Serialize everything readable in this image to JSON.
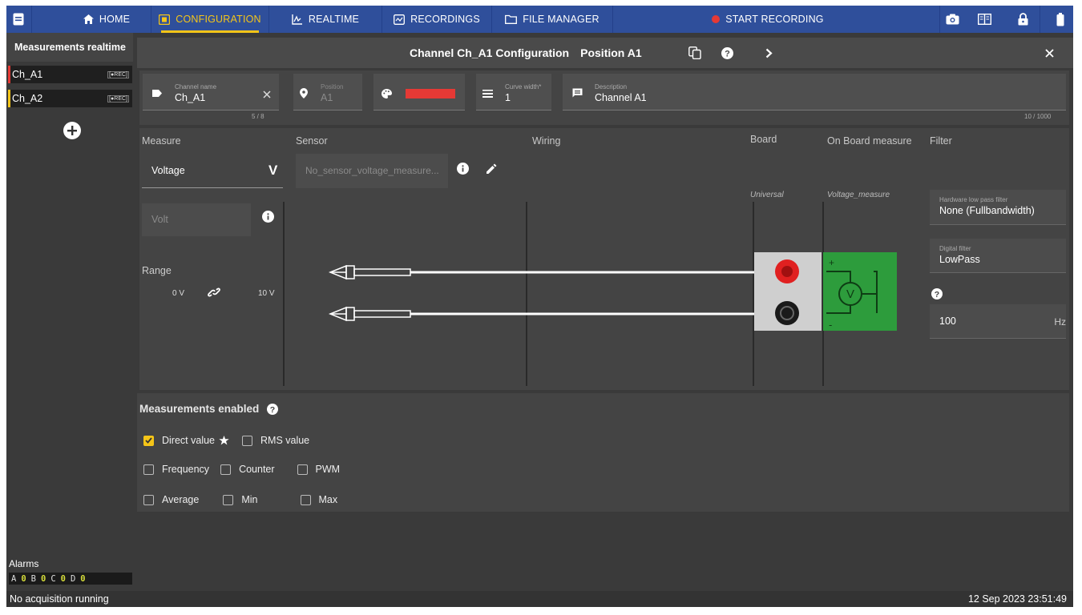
{
  "nav": {
    "tabs": [
      {
        "label": "HOME",
        "icon": "home-icon"
      },
      {
        "label": "CONFIGURATION",
        "icon": "settings-chip-icon"
      },
      {
        "label": "REALTIME",
        "icon": "realtime-icon"
      },
      {
        "label": "RECORDINGS",
        "icon": "recordings-icon"
      },
      {
        "label": "FILE MANAGER",
        "icon": "folder-icon"
      }
    ],
    "start_recording": "START RECORDING",
    "active_tab": "CONFIGURATION"
  },
  "sidebar": {
    "title": "Measurements realtime",
    "channels": [
      {
        "name": "Ch_A1",
        "tag": "[●REC]",
        "color": "#e53935"
      },
      {
        "name": "Ch_A2",
        "tag": "[●REC]",
        "color": "#f5c518"
      }
    ],
    "alarms_label": "Alarms",
    "alarms": [
      {
        "key": "A",
        "value": "0"
      },
      {
        "key": "B",
        "value": "0"
      },
      {
        "key": "C",
        "value": "0"
      },
      {
        "key": "D",
        "value": "0"
      }
    ]
  },
  "header": {
    "title": "Channel Ch_A1 Configuration",
    "position": "Position A1"
  },
  "channel": {
    "name_label": "Channel name",
    "name": "Ch_A1",
    "name_counter": "5 / 8",
    "position_label": "Position",
    "position": "A1",
    "color": "#e53935",
    "curve_width_label": "Curve width*",
    "curve_width": "1",
    "description_label": "Description",
    "description": "Channel A1",
    "description_counter": "10 / 1000"
  },
  "config": {
    "headers": {
      "measure": "Measure",
      "sensor": "Sensor",
      "wiring": "Wiring",
      "board": "Board",
      "onboard": "On Board measure",
      "filter": "Filter"
    },
    "measure_value": "Voltage",
    "measure_symbol": "V",
    "sensor_value": "No_sensor_voltage_measure...",
    "unit_value": "Volt",
    "range_label": "Range",
    "range_min": "0 V",
    "range_max": "10 V",
    "board_type": "Universal",
    "onboard_type": "Voltage_measure",
    "hw_filter_label": "Hardware low pass filter",
    "hw_filter_value": "None (Fullbandwidth)",
    "digital_filter_label": "Digital filter",
    "digital_filter_value": "LowPass",
    "cutoff_value": "100",
    "cutoff_unit": "Hz",
    "plus_sign": "+",
    "minus_sign": "-",
    "voltmeter_symbol": "V"
  },
  "measurements": {
    "title": "Measurements enabled",
    "items": [
      {
        "label": "Direct value",
        "checked": true,
        "starred": true
      },
      {
        "label": "RMS value",
        "checked": false
      },
      {
        "label": "Frequency",
        "checked": false
      },
      {
        "label": "Counter",
        "checked": false
      },
      {
        "label": "PWM",
        "checked": false
      },
      {
        "label": "Average",
        "checked": false
      },
      {
        "label": "Min",
        "checked": false
      },
      {
        "label": "Max",
        "checked": false
      }
    ]
  },
  "status": {
    "acquisition": "No acquisition running",
    "datetime": "12 Sep 2023 23:51:49"
  }
}
